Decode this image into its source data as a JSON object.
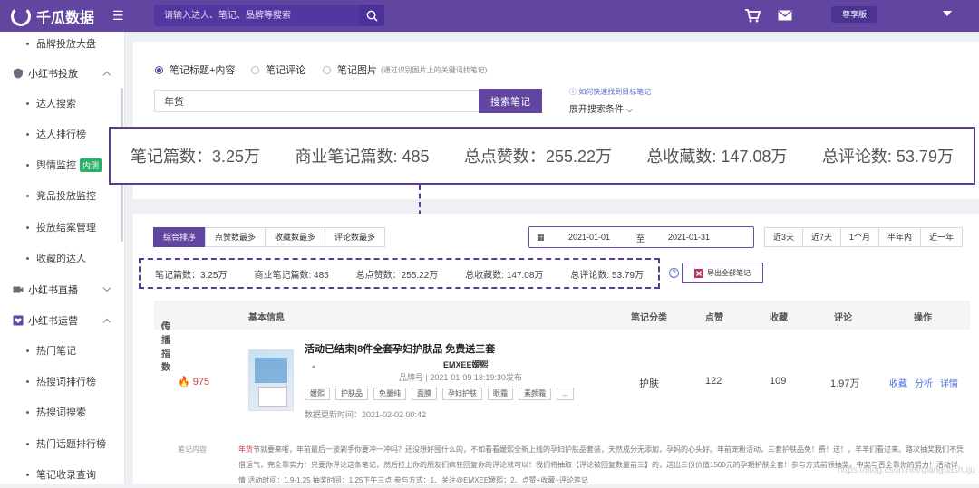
{
  "topbar": {
    "brand": "千瓜数据",
    "search_placeholder": "请输入达人、笔记、品牌等搜索",
    "plan": "尊享版",
    "accent": "#6145a0"
  },
  "sidebar": {
    "items": [
      {
        "label": "品牌投放大盘",
        "kind": "sub"
      },
      {
        "label": "小红书投放",
        "kind": "group",
        "icon": "shield-icon",
        "open": true
      },
      {
        "label": "达人搜索",
        "kind": "sub"
      },
      {
        "label": "达人排行榜",
        "kind": "sub"
      },
      {
        "label": "舆情监控",
        "kind": "sub",
        "badge": "内测"
      },
      {
        "label": "竞品投放监控",
        "kind": "sub"
      },
      {
        "label": "投放结案管理",
        "kind": "sub"
      },
      {
        "label": "收藏的达人",
        "kind": "sub"
      },
      {
        "label": "小红书直播",
        "kind": "group",
        "icon": "video-icon",
        "open": false
      },
      {
        "label": "小红书运营",
        "kind": "group",
        "icon": "heart-icon",
        "open": true
      },
      {
        "label": "热门笔记",
        "kind": "sub"
      },
      {
        "label": "热搜词排行榜",
        "kind": "sub"
      },
      {
        "label": "热搜词搜索",
        "kind": "sub"
      },
      {
        "label": "热门话题排行榜",
        "kind": "sub"
      },
      {
        "label": "笔记收录查询",
        "kind": "sub"
      }
    ]
  },
  "search_panel": {
    "options": [
      {
        "label": "笔记标题+内容",
        "checked": true
      },
      {
        "label": "笔记评论",
        "checked": false
      },
      {
        "label": "笔记图片",
        "checked": false,
        "hint": "(通过识别图片上的关键词找笔记)"
      }
    ],
    "keyword": "年货",
    "search_button": "搜索笔记",
    "howto_link": "如何快速找到目标笔记",
    "expand_label": "展开搜索条件"
  },
  "stats_big": {
    "notes": "笔记篇数：3.25万",
    "business_notes": "商业笔记篇数: 485",
    "likes": "总点赞数：255.22万",
    "favorites": "总收藏数: 147.08万",
    "comments": "总评论数: 53.79万"
  },
  "sort_tabs": [
    "综合排序",
    "点赞数最多",
    "收藏数最多",
    "评论数最多"
  ],
  "date_range": {
    "start": "2021-01-01",
    "sep": "至",
    "end": "2021-01-31"
  },
  "quick_ranges": [
    "近3天",
    "近7天",
    "1个月",
    "半年内",
    "近一年"
  ],
  "stats_small": {
    "notes": "笔记篇数：3.25万",
    "business_notes": "商业笔记篇数: 485",
    "likes": "总点赞数：255.22万",
    "favorites": "总收藏数: 147.08万",
    "comments": "总评论数: 53.79万"
  },
  "export_button": "导出全部笔记",
  "table": {
    "headers": {
      "spread": "传播指数",
      "basic": "基本信息",
      "category": "笔记分类",
      "likes": "点赞",
      "favorites": "收藏",
      "comments": "评论",
      "actions": "操作"
    },
    "row": {
      "spread_index": "975",
      "title": "活动已结束|8件全套孕妇护肤品 免费送三套",
      "author": "EMXEE媛熙",
      "meta": "品牌号 | 2021-01-09 18:19:30发布",
      "tags": [
        "媛熙",
        "护肤品",
        "免量纯",
        "面膜",
        "孕妇护肤",
        "眼霜",
        "素颜霜",
        "..."
      ],
      "updated": "数据更新时间：2021-02-02 00:42",
      "category": "护肤",
      "likes": "122",
      "favorites": "109",
      "comments": "1.97万",
      "actions": [
        "收藏",
        "分析",
        "详情"
      ],
      "content_label": "笔记内容",
      "content_highlight": "年货",
      "content_text": "节就要来啦，年前最后一波剁手你要冲一冲吗？还没想好囤什么的，不如看看媛熙全新上线的孕妇护肤品套装，天然成分无添加，孕妈的心头好。年前宠粉活动，三套护肤品免！费！送！，羊羊们看过来。路次抽奖我们不凭借运气，完全靠实力！只要你评论这条笔记，然后拉上你的朋友们疯狂回复你的评论就可以！我们将抽取【评论被回复数量前三】的，送出三份价值1500元的孕期护肤全套！参与方式前领抽奖。中奖与否全靠你的努力！活动详情 活动时间：1.9-1.25 抽奖时间：1.25下午三点 参与方式：1、关注@EMXEE媛熙；2、点赞+收藏+评论笔记"
    }
  },
  "watermark": "https://blog.csdn.net/qianguashuju"
}
